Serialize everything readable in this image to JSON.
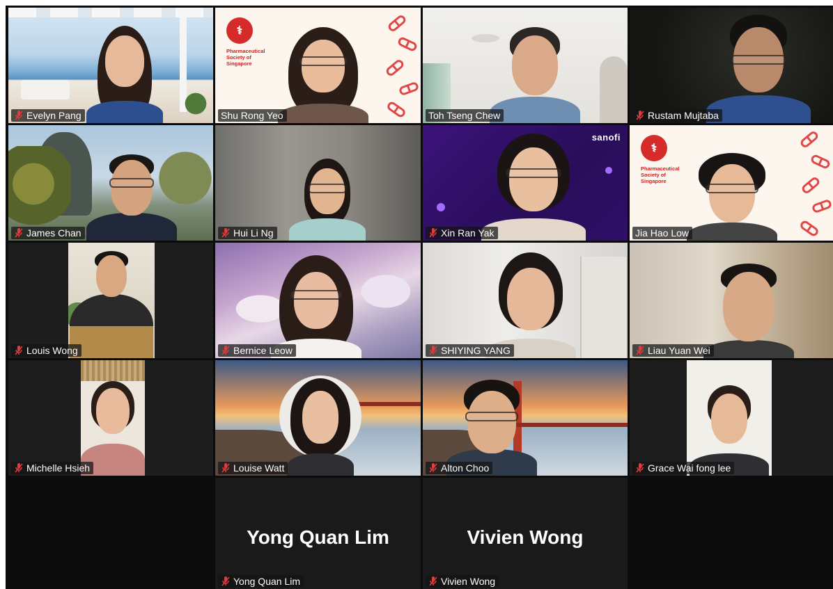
{
  "meeting": {
    "participants": [
      "Evelyn Pang",
      "Shu Rong Yeo",
      "Toh Tseng Chew",
      "Rustam Mujtaba",
      "James Chan",
      "Hui Li Ng",
      "Xin Ran Yak",
      "Jia Hao Low",
      "Louis Wong",
      "Bernice Leow",
      "SHIYING YANG",
      "Liau Yuan Wei",
      "Michelle Hsieh",
      "Louise Watt",
      "Alton Choo",
      "Grace Wai fong lee",
      "Yong Quan Lim",
      "Vivien Wong"
    ],
    "camera_off_names": [
      "Yong Quan Lim",
      "Vivien Wong"
    ],
    "background_logo": {
      "line1": "Pharmaceutical",
      "line2": "Society of",
      "line3": "Singapore"
    },
    "sponsor_logo": "sanofi",
    "mic_icon": "muted-microphone-icon",
    "accent_color": "#e03c3c"
  }
}
